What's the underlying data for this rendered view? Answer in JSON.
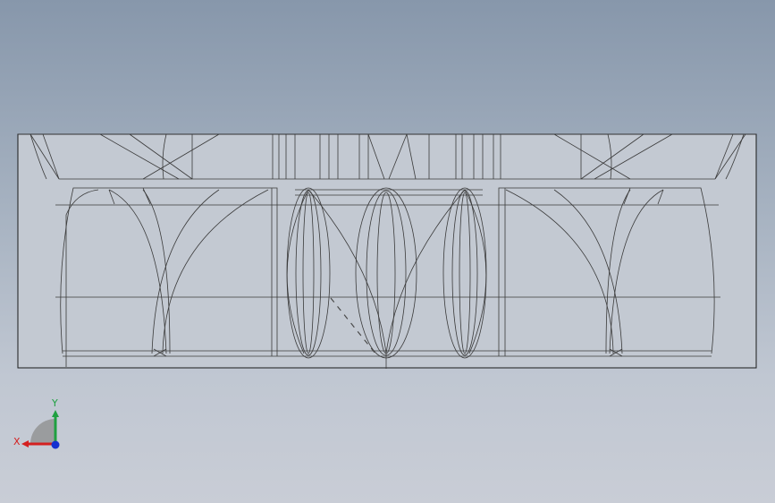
{
  "viewport": {
    "name": "graphics-area"
  },
  "triad": {
    "x_label": "X",
    "y_label": "Y",
    "x_color": "#d42020",
    "y_color": "#1fa040",
    "z_color": "#1530d0"
  }
}
